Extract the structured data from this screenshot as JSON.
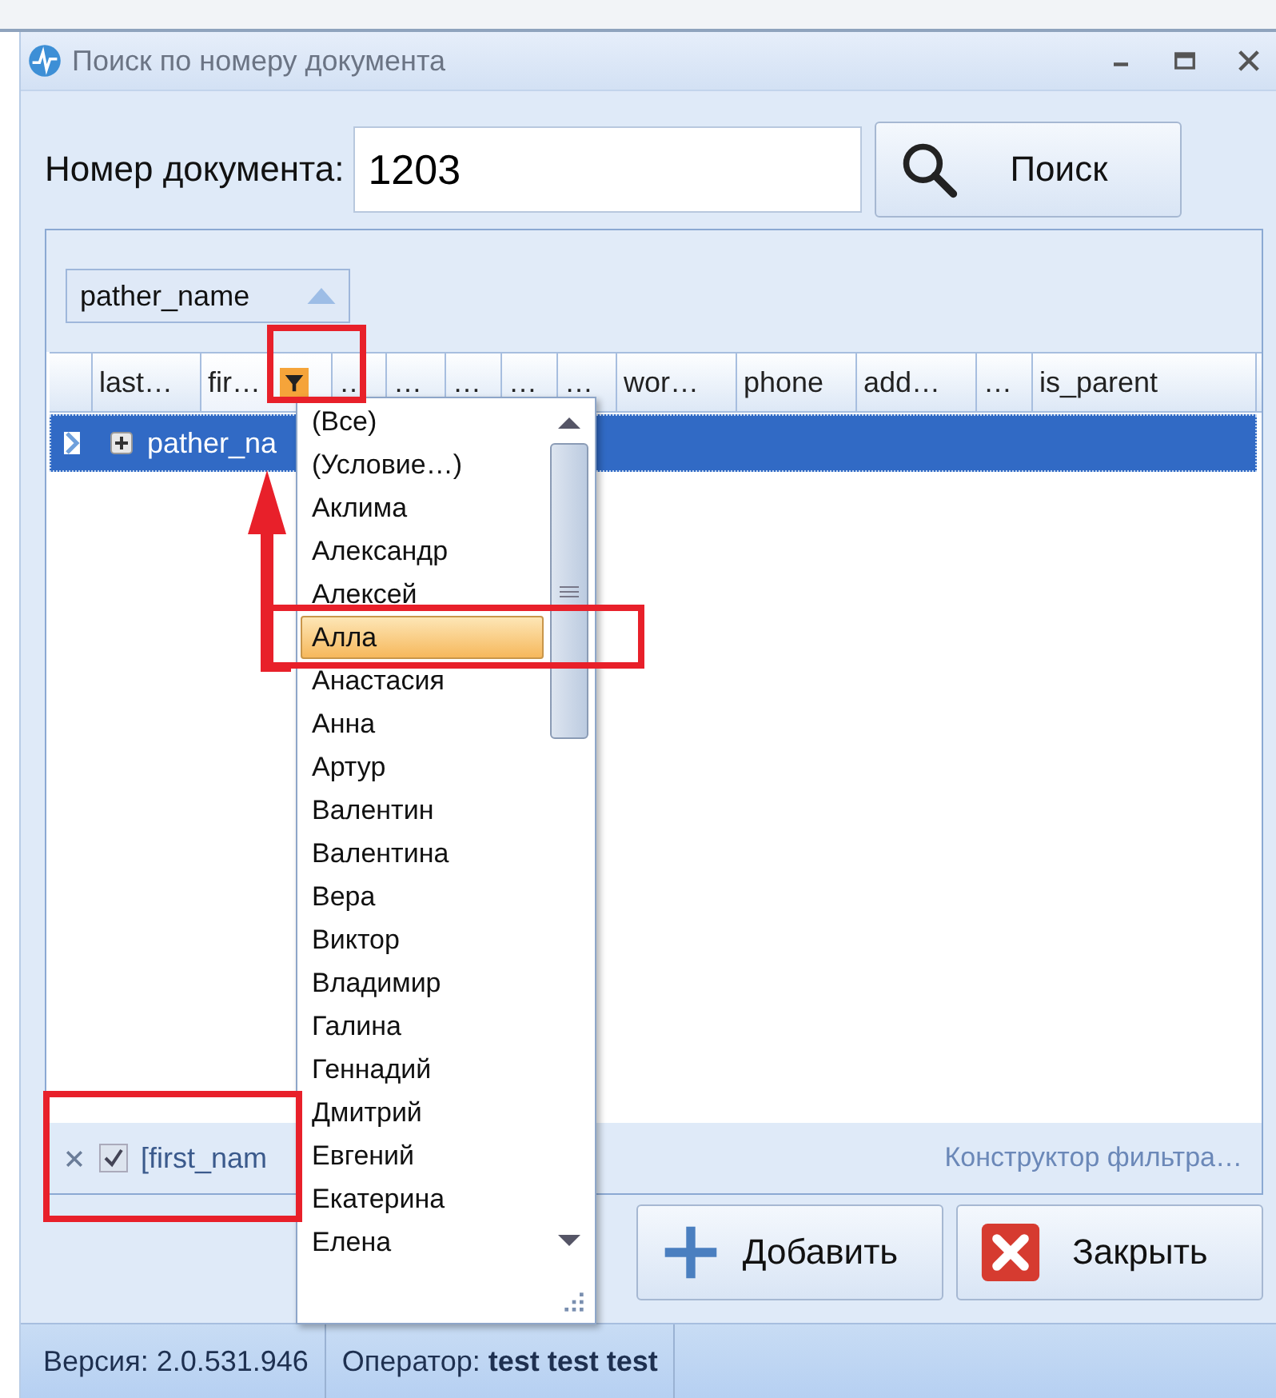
{
  "window": {
    "title": "Поиск по номеру документа"
  },
  "search": {
    "label": "Номер документа:",
    "value": "1203",
    "button": "Поиск"
  },
  "grid": {
    "group_by": "pather_name",
    "columns": [
      {
        "label": "last…",
        "filter_button": false
      },
      {
        "label": "fir…",
        "filter_button": true
      },
      {
        "label": "…",
        "filter_button": false
      },
      {
        "label": "…",
        "filter_button": false
      },
      {
        "label": "…",
        "filter_button": false
      },
      {
        "label": "…",
        "filter_button": false
      },
      {
        "label": "…",
        "filter_button": false
      },
      {
        "label": "wor…",
        "filter_button": false
      },
      {
        "label": "phone",
        "filter_button": false
      },
      {
        "label": "add…",
        "filter_button": false
      },
      {
        "label": "…",
        "filter_button": false
      },
      {
        "label": "is_parent",
        "filter_button": false
      }
    ],
    "rows": [
      {
        "text": "pather_na",
        "selected": true,
        "expanded": false
      }
    ],
    "filter": {
      "enabled": true,
      "text": "[first_nam",
      "builder_link": "Конструктор фильтра…"
    }
  },
  "filter_dropdown": {
    "items": [
      {
        "label": "(Все)",
        "selected": false
      },
      {
        "label": "(Условие…)",
        "selected": false
      },
      {
        "label": "Аклима",
        "selected": false
      },
      {
        "label": "Александр",
        "selected": false
      },
      {
        "label": "Алексей",
        "selected": false
      },
      {
        "label": "Алла",
        "selected": true
      },
      {
        "label": "Анастасия",
        "selected": false
      },
      {
        "label": "Анна",
        "selected": false
      },
      {
        "label": "Артур",
        "selected": false
      },
      {
        "label": "Валентин",
        "selected": false
      },
      {
        "label": "Валентина",
        "selected": false
      },
      {
        "label": "Вера",
        "selected": false
      },
      {
        "label": "Виктор",
        "selected": false
      },
      {
        "label": "Владимир",
        "selected": false
      },
      {
        "label": "Галина",
        "selected": false
      },
      {
        "label": "Геннадий",
        "selected": false
      },
      {
        "label": "Дмитрий",
        "selected": false
      },
      {
        "label": "Евгений",
        "selected": false
      },
      {
        "label": "Екатерина",
        "selected": false
      },
      {
        "label": "Елена",
        "selected": false
      }
    ]
  },
  "buttons": [
    {
      "label": "Добавить",
      "kind": "add"
    },
    {
      "label": "Закрыть",
      "kind": "close"
    }
  ],
  "status_bar": {
    "version": "Версия: 2.0.531.946",
    "operator_label": "Оператор:",
    "operator": "test test test"
  }
}
